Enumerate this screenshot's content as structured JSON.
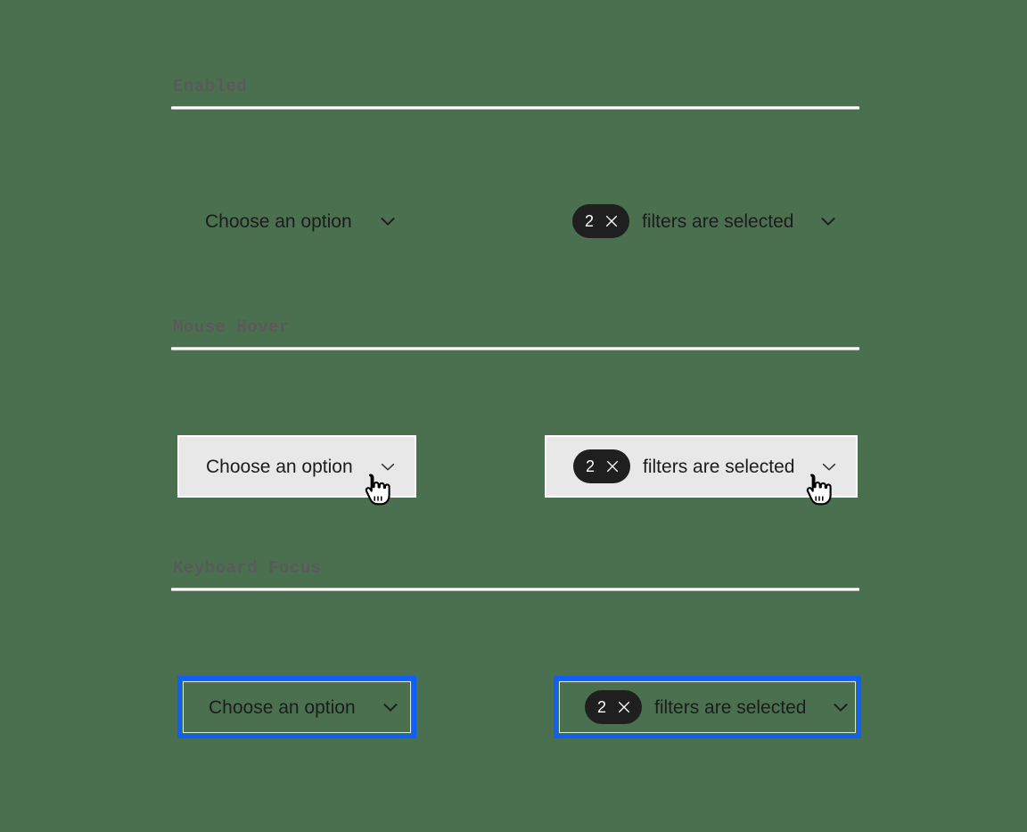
{
  "page": {
    "background_color": "#4a7050",
    "accent_focus_color": "#0f5fff",
    "tag_color": "#1f1f1f",
    "hover_fill_color": "#e8e8e8"
  },
  "sections": [
    {
      "id": "enabled",
      "title": "Enabled",
      "dropdown": {
        "label": "Choose an option",
        "chevron_icon": "chevron-down-icon"
      },
      "multiselect": {
        "count": "2",
        "close_icon": "close-icon",
        "label": "filters are selected",
        "chevron_icon": "chevron-down-icon"
      }
    },
    {
      "id": "mouse-hover",
      "title": "Mouse Hover",
      "dropdown": {
        "label": "Choose an option",
        "chevron_icon": "chevron-down-icon"
      },
      "multiselect": {
        "count": "2",
        "close_icon": "close-icon",
        "label": "filters are selected",
        "chevron_icon": "chevron-down-icon"
      },
      "cursor_icon": "pointing-hand-cursor"
    },
    {
      "id": "keyboard-focus",
      "title": "Keyboard Focus",
      "dropdown": {
        "label": "Choose an option",
        "chevron_icon": "chevron-down-icon"
      },
      "multiselect": {
        "count": "2",
        "close_icon": "close-icon",
        "label": "filters are selected",
        "chevron_icon": "chevron-down-icon"
      }
    }
  ]
}
